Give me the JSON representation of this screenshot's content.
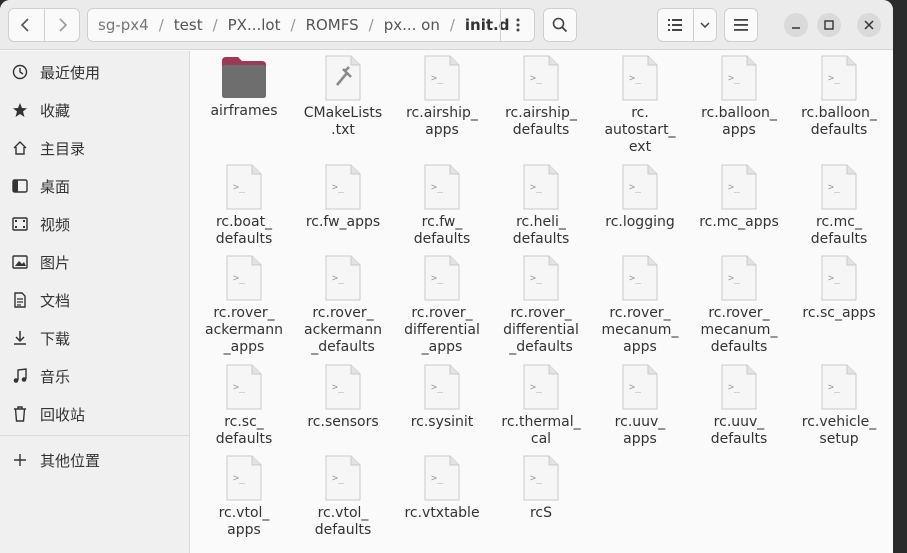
{
  "window": {
    "title": "init.d"
  },
  "path": {
    "segments": [
      "sg-px4",
      "test",
      "PX...lot",
      "ROMFS",
      "px... on",
      "init.d"
    ],
    "separator": "/"
  },
  "sidebar": {
    "items": [
      {
        "label": "最近使用",
        "icon": "clock-icon"
      },
      {
        "label": "收藏",
        "icon": "star-icon"
      },
      {
        "label": "主目录",
        "icon": "home-icon"
      },
      {
        "label": "桌面",
        "icon": "desktop-icon"
      },
      {
        "label": "视频",
        "icon": "video-icon"
      },
      {
        "label": "图片",
        "icon": "picture-icon"
      },
      {
        "label": "文档",
        "icon": "document-icon"
      },
      {
        "label": "下载",
        "icon": "download-icon"
      },
      {
        "label": "音乐",
        "icon": "music-icon"
      },
      {
        "label": "回收站",
        "icon": "trash-icon"
      }
    ],
    "other": {
      "label": "其他位置",
      "icon": "plus-icon"
    }
  },
  "files": [
    {
      "lines": [
        "airframes"
      ],
      "kind": "folder"
    },
    {
      "lines": [
        "CMakeLists",
        ".txt"
      ],
      "kind": "cmake"
    },
    {
      "lines": [
        "rc.airship_",
        "apps"
      ],
      "kind": "script"
    },
    {
      "lines": [
        "rc.airship_",
        "defaults"
      ],
      "kind": "script"
    },
    {
      "lines": [
        "rc.",
        "autostart_",
        "ext"
      ],
      "kind": "script"
    },
    {
      "lines": [
        "rc.balloon_",
        "apps"
      ],
      "kind": "script"
    },
    {
      "lines": [
        "rc.balloon_",
        "defaults"
      ],
      "kind": "script"
    },
    {
      "lines": [
        "rc.boat_",
        "defaults"
      ],
      "kind": "script"
    },
    {
      "lines": [
        "rc.fw_apps"
      ],
      "kind": "script"
    },
    {
      "lines": [
        "rc.fw_",
        "defaults"
      ],
      "kind": "script"
    },
    {
      "lines": [
        "rc.heli_",
        "defaults"
      ],
      "kind": "script"
    },
    {
      "lines": [
        "rc.logging"
      ],
      "kind": "script"
    },
    {
      "lines": [
        "rc.mc_apps"
      ],
      "kind": "script"
    },
    {
      "lines": [
        "rc.mc_",
        "defaults"
      ],
      "kind": "script"
    },
    {
      "lines": [
        "rc.rover_",
        "ackermann",
        "_apps"
      ],
      "kind": "script"
    },
    {
      "lines": [
        "rc.rover_",
        "ackermann",
        "_defaults"
      ],
      "kind": "script"
    },
    {
      "lines": [
        "rc.rover_",
        "differential",
        "_apps"
      ],
      "kind": "script"
    },
    {
      "lines": [
        "rc.rover_",
        "differential",
        "_defaults"
      ],
      "kind": "script"
    },
    {
      "lines": [
        "rc.rover_",
        "mecanum_",
        "apps"
      ],
      "kind": "script"
    },
    {
      "lines": [
        "rc.rover_",
        "mecanum_",
        "defaults"
      ],
      "kind": "script"
    },
    {
      "lines": [
        "rc.sc_apps"
      ],
      "kind": "script"
    },
    {
      "lines": [
        "rc.sc_",
        "defaults"
      ],
      "kind": "script"
    },
    {
      "lines": [
        "rc.sensors"
      ],
      "kind": "script"
    },
    {
      "lines": [
        "rc.sysinit"
      ],
      "kind": "script"
    },
    {
      "lines": [
        "rc.thermal_",
        "cal"
      ],
      "kind": "script"
    },
    {
      "lines": [
        "rc.uuv_",
        "apps"
      ],
      "kind": "script"
    },
    {
      "lines": [
        "rc.uuv_",
        "defaults"
      ],
      "kind": "script"
    },
    {
      "lines": [
        "rc.vehicle_",
        "setup"
      ],
      "kind": "script"
    },
    {
      "lines": [
        "rc.vtol_",
        "apps"
      ],
      "kind": "script"
    },
    {
      "lines": [
        "rc.vtol_",
        "defaults"
      ],
      "kind": "script"
    },
    {
      "lines": [
        "rc.vtxtable"
      ],
      "kind": "script"
    },
    {
      "lines": [
        "rcS"
      ],
      "kind": "script"
    }
  ]
}
